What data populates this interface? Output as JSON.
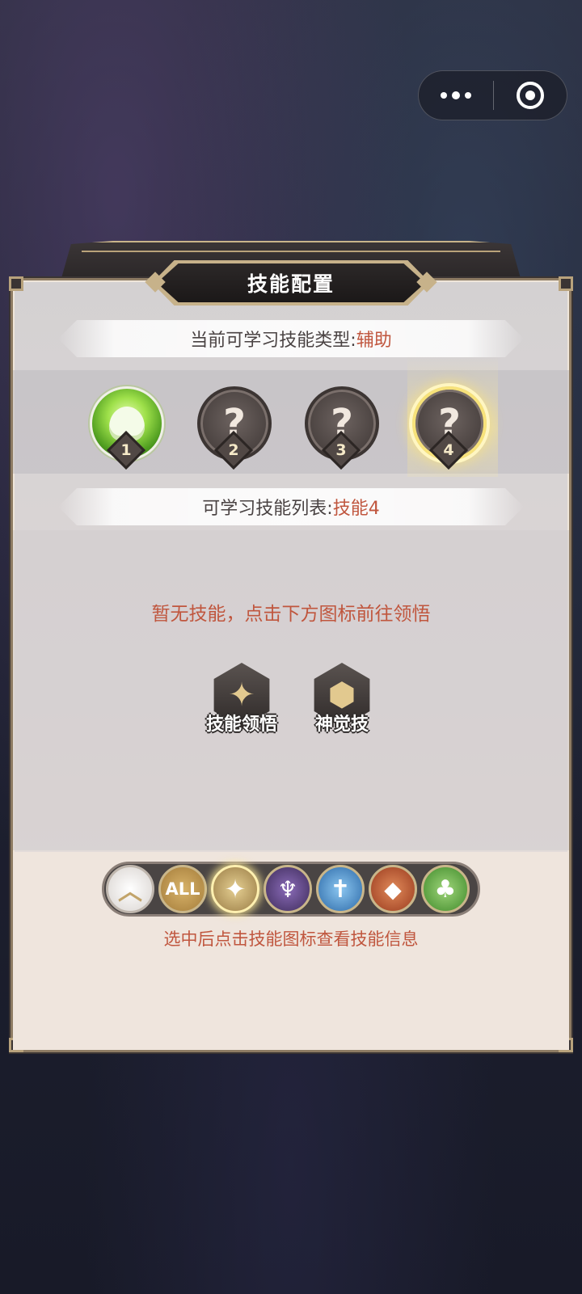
{
  "capsule": {
    "more_icon": "more-dots-icon",
    "close_icon": "target-circle-icon"
  },
  "panel": {
    "title": "技能配置",
    "learnable_type_label": "当前可学习技能类型:",
    "learnable_type_value": "辅助",
    "list_label": "可学习技能列表:",
    "list_value": "技能4",
    "empty_message": "暂无技能，点击下方图标前往领悟",
    "hint": "选中后点击技能图标查看技能信息"
  },
  "slots": [
    {
      "number": "1",
      "state": "learned",
      "icon": "bell-flower-icon"
    },
    {
      "number": "2",
      "state": "empty",
      "glyph": "?"
    },
    {
      "number": "3",
      "state": "empty",
      "glyph": "?"
    },
    {
      "number": "4",
      "state": "selected",
      "glyph": "?"
    }
  ],
  "actions": [
    {
      "label": "技能领悟",
      "icon": "star-shield-icon",
      "glyph": "✦"
    },
    {
      "label": "神觉技",
      "icon": "rune-crest-icon",
      "glyph": "⬢"
    }
  ],
  "filters": [
    {
      "id": "collapse",
      "glyph": "︿",
      "icon": "chevron-up-icon"
    },
    {
      "id": "all",
      "glyph": "ALL",
      "icon": "all-icon"
    },
    {
      "id": "star",
      "glyph": "✦",
      "icon": "star-faction-icon",
      "selected": true
    },
    {
      "id": "demon",
      "glyph": "♆",
      "icon": "demon-faction-icon"
    },
    {
      "id": "holy",
      "glyph": "✝",
      "icon": "holy-faction-icon"
    },
    {
      "id": "beast",
      "glyph": "◆",
      "icon": "beast-faction-icon"
    },
    {
      "id": "nature",
      "glyph": "♣",
      "icon": "nature-faction-icon"
    }
  ],
  "colors": {
    "accent": "#c0563e",
    "gold": "#c9b68a"
  }
}
